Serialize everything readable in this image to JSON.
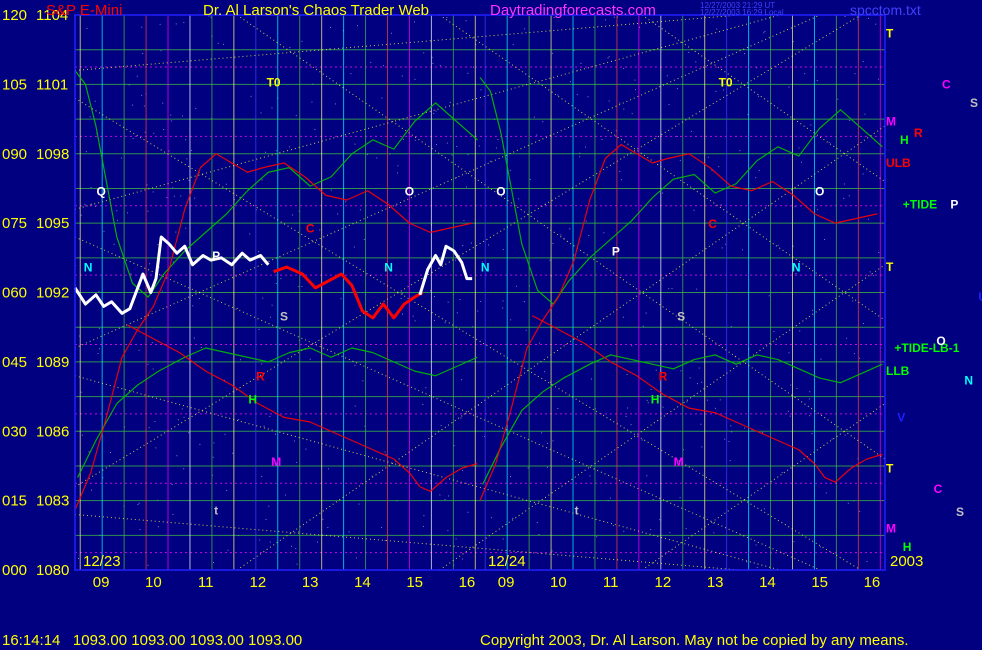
{
  "header": {
    "instrument": "S&P E-Mini",
    "title": "Dr. Al Larson's Chaos Trader Web",
    "site": "Daytradingforecasts.com",
    "file": "spcctom.txt",
    "stamp1": "12/27/2003 21:29 UT",
    "stamp2": "12/27/2003 16:29 Local",
    "year": "2003"
  },
  "footer": {
    "quote": "16:14:14   1093.00 1093.00 1093.00 1093.00",
    "copyright": "Copyright 2003, Dr. Al Larson. May not be copied by any means."
  },
  "colors": {
    "background": "#000080",
    "plot_border": "#2020ff",
    "price_up": "#ffffff",
    "price_down": "#ff0000",
    "green_line": "#00c000",
    "red_line": "#e00000",
    "grid_yellow": "#ffff00",
    "grid_green": "#40c040",
    "grid_magenta": "#ff00ff",
    "cyan_marker": "#00ffff"
  },
  "chart_data": {
    "type": "line",
    "title": "S&P E-Mini",
    "y_axis": {
      "label": "",
      "ylim": [
        1080,
        1104
      ],
      "left_ticks": [
        "000",
        "015",
        "030",
        "045",
        "060",
        "075",
        "090",
        "105",
        "120"
      ],
      "right_ticks": [
        "1080",
        "1083",
        "1086",
        "1089",
        "1092",
        "1095",
        "1098",
        "1101",
        "1104"
      ]
    },
    "x_axis": {
      "hour_ticks": [
        "09",
        "10",
        "11",
        "12",
        "13",
        "14",
        "15",
        "16",
        "09",
        "10",
        "11",
        "12",
        "13",
        "14",
        "15",
        "16"
      ],
      "session_dates": [
        "12/23",
        "12/24"
      ],
      "hour_range": [
        8.5,
        16.25
      ]
    },
    "series": [
      {
        "name": "",
        "color": "white",
        "x": [
          8.5,
          8.7,
          8.9,
          9.05,
          9.2,
          9.4,
          9.55,
          9.7,
          9.8,
          9.95,
          10.05,
          10.15,
          10.3,
          10.45,
          10.6,
          10.75,
          10.95,
          11.1,
          11.3,
          11.5,
          11.7,
          11.85,
          12.05,
          12.2
        ],
        "values": [
          1092.2,
          1091.5,
          1091.9,
          1091.4,
          1091.6,
          1091.1,
          1091.3,
          1092.2,
          1092.8,
          1092.0,
          1092.6,
          1094.4,
          1094.1,
          1093.7,
          1094.0,
          1093.2,
          1093.6,
          1093.4,
          1093.5,
          1093.2,
          1093.7,
          1093.4,
          1093.6,
          1093.2
        ]
      },
      {
        "name": "",
        "color": "red",
        "x": [
          12.3,
          12.55,
          12.85,
          13.1,
          13.35,
          13.6,
          13.8,
          14.0,
          14.2,
          14.4,
          14.6,
          14.8,
          15.0,
          15.15
        ],
        "values": [
          1092.9,
          1093.1,
          1092.8,
          1092.2,
          1092.5,
          1092.8,
          1092.3,
          1091.2,
          1090.9,
          1091.5,
          1090.9,
          1091.5,
          1091.8,
          1092.0
        ]
      },
      {
        "name": "",
        "color": "white",
        "x": [
          15.1,
          15.25,
          15.4,
          15.5,
          15.6,
          15.75,
          15.9,
          16.0,
          16.1
        ],
        "values": [
          1091.9,
          1093.0,
          1093.6,
          1093.2,
          1094.0,
          1093.8,
          1093.3,
          1092.6,
          1092.6
        ]
      },
      {
        "name": "",
        "color": "green",
        "x": [
          8.5,
          8.7,
          8.9,
          9.1,
          9.3,
          9.6,
          9.9,
          10.2,
          10.6,
          11.0,
          11.4,
          11.8,
          12.2,
          12.6,
          13.0,
          13.4,
          13.8,
          14.2,
          14.6,
          15.0,
          15.4,
          15.8,
          16.2
        ],
        "values": [
          1101.6,
          1101.0,
          1099.2,
          1096.8,
          1094.4,
          1092.4,
          1091.8,
          1092.8,
          1093.8,
          1094.6,
          1095.4,
          1096.4,
          1097.2,
          1097.4,
          1096.6,
          1097.0,
          1098.0,
          1098.6,
          1098.2,
          1099.4,
          1100.2,
          1099.4,
          1098.6
        ]
      },
      {
        "name": "",
        "color": "green",
        "x": [
          8.55,
          8.9,
          9.3,
          9.7,
          10.1,
          10.6,
          11.0,
          11.4,
          11.8,
          12.2,
          12.6,
          13.0,
          13.4,
          13.8,
          14.2,
          14.6,
          15.0,
          15.4,
          15.8,
          16.2
        ],
        "values": [
          1084.0,
          1085.6,
          1087.2,
          1088.0,
          1088.6,
          1089.2,
          1089.6,
          1089.4,
          1089.2,
          1089.0,
          1089.4,
          1089.6,
          1089.2,
          1089.6,
          1089.4,
          1089.0,
          1088.6,
          1088.4,
          1088.8,
          1089.2
        ]
      },
      {
        "name": "",
        "color": "red",
        "x": [
          8.5,
          8.8,
          9.1,
          9.4,
          9.7,
          10.0,
          10.3,
          10.6,
          10.9,
          11.2,
          11.5,
          11.8,
          12.1,
          12.5,
          12.9,
          13.3,
          13.7,
          14.1,
          14.5,
          14.9,
          15.3,
          15.7,
          16.1
        ],
        "values": [
          1082.6,
          1084.2,
          1086.6,
          1089.2,
          1090.4,
          1091.4,
          1093.0,
          1095.6,
          1097.4,
          1098.0,
          1097.6,
          1097.2,
          1097.4,
          1097.6,
          1097.0,
          1096.2,
          1096.0,
          1096.4,
          1095.8,
          1095.0,
          1094.6,
          1094.8,
          1095.0
        ]
      },
      {
        "name": "",
        "color": "red",
        "x": [
          9.5,
          10.0,
          10.5,
          11.0,
          11.5,
          12.0,
          12.5,
          13.0,
          13.4,
          13.8,
          14.2,
          14.6,
          14.9,
          15.1,
          15.3,
          15.6,
          15.9,
          16.2
        ],
        "values": [
          1090.6,
          1090.0,
          1089.4,
          1088.6,
          1088.0,
          1087.2,
          1086.6,
          1086.4,
          1086.0,
          1085.6,
          1085.2,
          1084.8,
          1084.2,
          1083.6,
          1083.4,
          1084.0,
          1084.4,
          1084.6
        ]
      }
    ],
    "symbols": [
      {
        "text": "Q",
        "x": 9.0,
        "y": 1096.2,
        "color": "white"
      },
      {
        "text": "N",
        "x": 8.75,
        "y": 1092.9,
        "color": "#00ffff"
      },
      {
        "text": "T0",
        "x": 12.3,
        "y": 1100.9,
        "color": "#ffff00"
      },
      {
        "text": "C",
        "x": 13.0,
        "y": 1094.6,
        "color": "red"
      },
      {
        "text": "P",
        "x": 11.2,
        "y": 1093.4,
        "color": "white"
      },
      {
        "text": "S",
        "x": 12.5,
        "y": 1090.8,
        "color": "#c0c0c0"
      },
      {
        "text": "R",
        "x": 12.05,
        "y": 1088.2,
        "color": "red"
      },
      {
        "text": "H",
        "x": 11.9,
        "y": 1087.2,
        "color": "#00ff00"
      },
      {
        "text": "M",
        "x": 12.35,
        "y": 1084.5,
        "color": "#ff00ff"
      },
      {
        "text": "t",
        "x": 11.2,
        "y": 1082.4,
        "color": "#c0c0c0"
      },
      {
        "text": "O",
        "x": 14.9,
        "y": 1096.2,
        "color": "white"
      },
      {
        "text": "N",
        "x": 14.5,
        "y": 1092.9,
        "color": "#00ffff"
      },
      {
        "text": "O",
        "x": 8.9,
        "y": 1096.2,
        "color": "white",
        "session": 2
      },
      {
        "text": "N",
        "x": 8.6,
        "y": 1092.9,
        "color": "#00ffff",
        "session": 2
      },
      {
        "text": "P",
        "x": 11.1,
        "y": 1093.6,
        "color": "white",
        "session": 2
      },
      {
        "text": "t",
        "x": 10.35,
        "y": 1082.4,
        "color": "#c0c0c0",
        "session": 2
      },
      {
        "text": "S",
        "x": 12.35,
        "y": 1090.8,
        "color": "#c0c0c0",
        "session": 2
      },
      {
        "text": "R",
        "x": 12.0,
        "y": 1088.2,
        "color": "red",
        "session": 2
      },
      {
        "text": "H",
        "x": 11.85,
        "y": 1087.2,
        "color": "#00ff00",
        "session": 2
      },
      {
        "text": "M",
        "x": 12.3,
        "y": 1084.5,
        "color": "#ff00ff",
        "session": 2
      },
      {
        "text": "T0",
        "x": 13.2,
        "y": 1100.9,
        "color": "#ffff00",
        "session": 2
      },
      {
        "text": "C",
        "x": 12.95,
        "y": 1094.8,
        "color": "red",
        "session": 2
      },
      {
        "text": "N",
        "x": 14.55,
        "y": 1092.9,
        "color": "#00ffff",
        "session": 2
      },
      {
        "text": "O",
        "x": 15.0,
        "y": 1096.2,
        "color": "white",
        "session": 2
      }
    ],
    "right_labels": [
      {
        "text": "T",
        "y": 1103.2,
        "color": "#ffff00"
      },
      {
        "text": "C",
        "y": 1101.0,
        "color": "#ff00ff",
        "offset": 2
      },
      {
        "text": "S",
        "y": 1100.2,
        "color": "#c0c0c0",
        "offset": 3
      },
      {
        "text": "M",
        "y": 1099.4,
        "color": "#ff00ff"
      },
      {
        "text": "R",
        "y": 1098.9,
        "color": "red",
        "offset": 1
      },
      {
        "text": "H",
        "y": 1098.6,
        "color": "#00ff00",
        "offset": 0.5
      },
      {
        "text": "ULB",
        "y": 1097.6,
        "color": "red"
      },
      {
        "text": "+TIDE",
        "y": 1095.8,
        "color": "#00ff00",
        "offset": 0.6
      },
      {
        "text": "P",
        "y": 1095.8,
        "color": "white",
        "offset": 2.3
      },
      {
        "text": "T",
        "y": 1093.1,
        "color": "#ffff00"
      },
      {
        "text": "U",
        "y": 1091.8,
        "color": "#2020ff",
        "offset": 3.3
      },
      {
        "text": "+TIDE-LB-1",
        "y": 1089.6,
        "color": "#00ff00",
        "offset": 0.3
      },
      {
        "text": "O",
        "y": 1089.9,
        "color": "white",
        "offset": 1.8
      },
      {
        "text": "LLB",
        "y": 1088.6,
        "color": "#00ff00"
      },
      {
        "text": "N",
        "y": 1088.2,
        "color": "#00ffff",
        "offset": 2.8
      },
      {
        "text": "V",
        "y": 1086.6,
        "color": "#2020ff",
        "offset": 0.4
      },
      {
        "text": "T",
        "y": 1084.4,
        "color": "#ffff00"
      },
      {
        "text": "C",
        "y": 1083.5,
        "color": "#ff00ff",
        "offset": 1.7
      },
      {
        "text": "S",
        "y": 1082.5,
        "color": "#c0c0c0",
        "offset": 2.5
      },
      {
        "text": "M",
        "y": 1081.8,
        "color": "#ff00ff"
      },
      {
        "text": "H",
        "y": 1081.0,
        "color": "#00ff00",
        "offset": 0.6
      }
    ]
  }
}
